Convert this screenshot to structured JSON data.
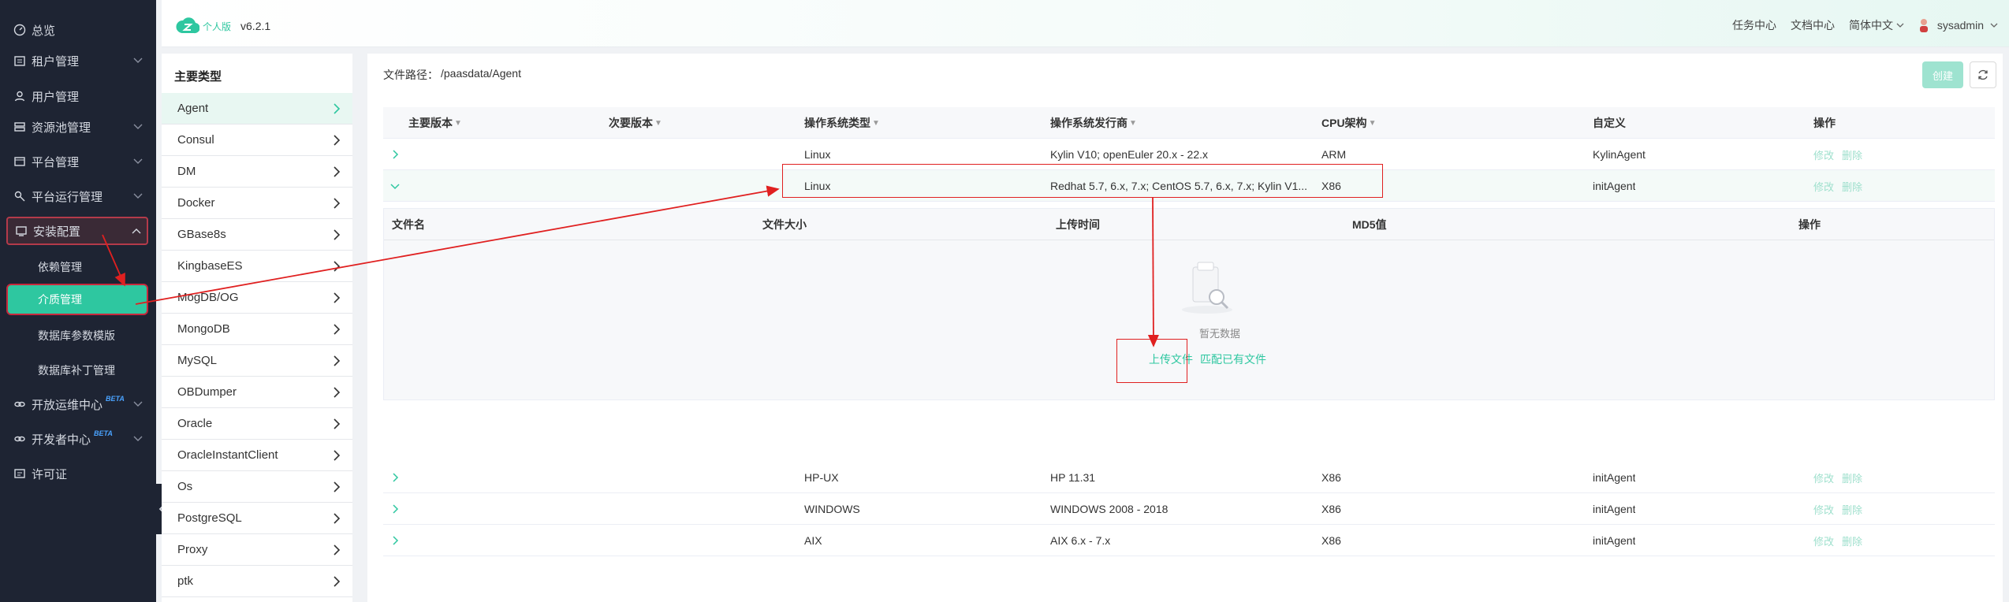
{
  "nav": {
    "items": [
      {
        "label": "总览",
        "icon": "dashboard-icon"
      },
      {
        "label": "租户管理",
        "icon": "tenant-icon"
      },
      {
        "label": "用户管理",
        "icon": "user-icon"
      },
      {
        "label": "资源池管理",
        "icon": "resource-icon"
      },
      {
        "label": "平台管理",
        "icon": "platform-icon"
      },
      {
        "label": "平台运行管理",
        "icon": "ops-icon"
      },
      {
        "label": "安装配置",
        "icon": "install-icon"
      },
      {
        "label": "开放运维中心",
        "icon": "link-icon",
        "badge": "BETA"
      },
      {
        "label": "开发者中心",
        "icon": "link-icon",
        "badge": "BETA"
      },
      {
        "label": "许可证",
        "icon": "license-icon"
      }
    ],
    "sub_items": [
      "依赖管理",
      "介质管理",
      "数据库参数模版",
      "数据库补丁管理"
    ]
  },
  "header": {
    "edition": "个人版",
    "version": "v6.2.1",
    "links": [
      "任务中心",
      "文档中心",
      "简体中文"
    ],
    "user": "sysadmin"
  },
  "categories": {
    "title": "主要类型",
    "items": [
      "Agent",
      "Consul",
      "DM",
      "Docker",
      "GBase8s",
      "KingbaseES",
      "MogDB/OG",
      "MongoDB",
      "MySQL",
      "OBDumper",
      "Oracle",
      "OracleInstantClient",
      "Os",
      "PostgreSQL",
      "Proxy",
      "ptk"
    ]
  },
  "main": {
    "path_label": "文件路径：",
    "path_value": "/paasdata/Agent",
    "create_label": "创建",
    "columns": [
      "主要版本",
      "次要版本",
      "操作系统类型",
      "操作系统发行商",
      "CPU架构",
      "自定义",
      "操作"
    ],
    "rows": [
      {
        "os_type": "Linux",
        "vendor": "Kylin V10; openEuler 20.x - 22.x",
        "cpu": "ARM",
        "custom": "KylinAgent"
      },
      {
        "os_type": "Linux",
        "vendor": "Redhat 5.7, 6.x, 7.x; CentOS 5.7, 6.x, 7.x; Kylin V1...",
        "cpu": "X86",
        "custom": "initAgent"
      },
      {
        "os_type": "HP-UX",
        "vendor": "HP 11.31",
        "cpu": "X86",
        "custom": "initAgent"
      },
      {
        "os_type": "WINDOWS",
        "vendor": "WINDOWS 2008 - 2018",
        "cpu": "X86",
        "custom": "initAgent"
      },
      {
        "os_type": "AIX",
        "vendor": "AIX 6.x - 7.x",
        "cpu": "X86",
        "custom": "initAgent"
      }
    ],
    "op_edit": "修改",
    "op_delete": "删除",
    "sub_columns": [
      "文件名",
      "文件大小",
      "上传时间",
      "MD5值",
      "操作"
    ],
    "empty_text": "暂无数据",
    "upload_label": "上传文件",
    "match_label": "匹配已有文件"
  },
  "colors": {
    "accent": "#2ec7a0",
    "nav_bg": "#1e2433",
    "annotation": "#e02020"
  }
}
